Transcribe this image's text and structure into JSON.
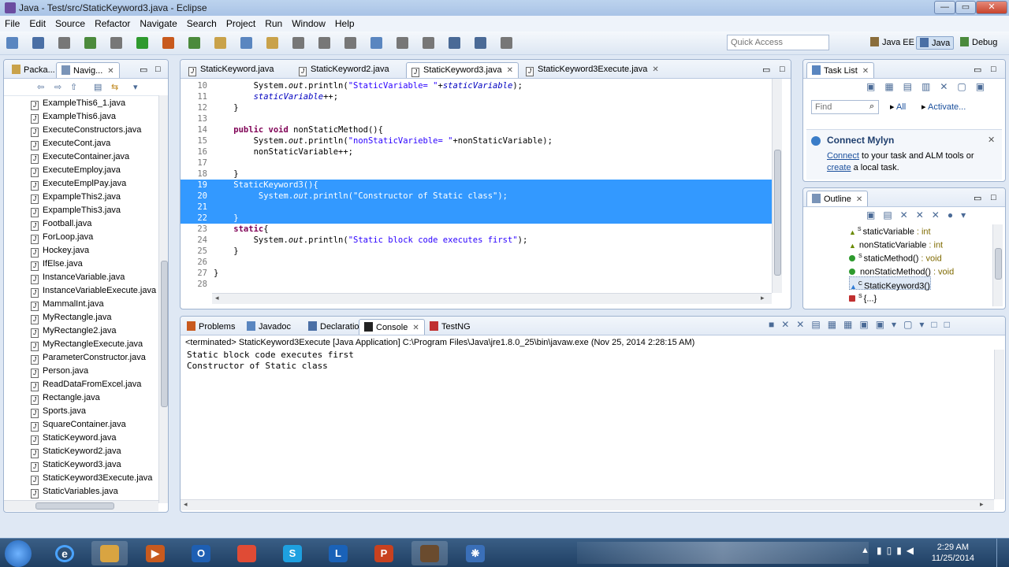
{
  "window": {
    "title": "Java - Test/src/StaticKeyword3.java - Eclipse",
    "min_label": "—",
    "max_label": "▭",
    "close_label": "✕"
  },
  "menu": [
    "File",
    "Edit",
    "Source",
    "Refactor",
    "Navigate",
    "Search",
    "Project",
    "Run",
    "Window",
    "Help"
  ],
  "toolbar": {
    "quick_access_placeholder": "Quick Access",
    "perspectives": [
      "Java EE",
      "Java",
      "Debug"
    ],
    "active_perspective": "Java"
  },
  "package_explorer": {
    "tabs": [
      "Packa...",
      "Navig..."
    ],
    "files": [
      "ExampleThis6_1.java",
      "ExampleThis6.java",
      "ExecuteConstructors.java",
      "ExecuteCont.java",
      "ExecuteContainer.java",
      "ExecuteEmploy.java",
      "ExecuteEmplPay.java",
      "ExpampleThis2.java",
      "ExpampleThis3.java",
      "Football.java",
      "ForLoop.java",
      "Hockey.java",
      "IfElse.java",
      "InstanceVariable.java",
      "InstanceVariableExecute.java",
      "MammalInt.java",
      "MyRectangle.java",
      "MyRectangle2.java",
      "MyRectangleExecute.java",
      "ParameterConstructor.java",
      "Person.java",
      "ReadDataFromExcel.java",
      "Rectangle.java",
      "Sports.java",
      "SquareContainer.java",
      "StaticKeyword.java",
      "StaticKeyword2.java",
      "StaticKeyword3.java",
      "StaticKeyword3Execute.java",
      "StaticVariables.java"
    ]
  },
  "editor": {
    "tabs": [
      "StaticKeyword.java",
      "StaticKeyword2.java",
      "StaticKeyword3.java",
      "StaticKeyword3Execute.java"
    ],
    "active_tab": "StaticKeyword3.java",
    "lines": [
      {
        "n": "10",
        "parts": [
          [
            "",
            "        System."
          ],
          [
            "it",
            "out"
          ],
          [
            "",
            ".println("
          ],
          [
            "str",
            "\"StaticVariable= \""
          ],
          [
            "",
            "+"
          ],
          [
            "fld",
            "staticVariable"
          ],
          [
            "",
            ");"
          ]
        ]
      },
      {
        "n": "11",
        "parts": [
          [
            "fld",
            "        staticVariable"
          ],
          [
            "",
            "++;"
          ]
        ]
      },
      {
        "n": "12",
        "parts": [
          [
            "",
            "    }"
          ]
        ]
      },
      {
        "n": "13",
        "parts": [
          [
            "",
            ""
          ]
        ]
      },
      {
        "n": "14",
        "parts": [
          [
            "kw",
            "    public void "
          ],
          [
            "",
            "nonStaticMethod(){"
          ]
        ]
      },
      {
        "n": "15",
        "parts": [
          [
            "",
            "        System."
          ],
          [
            "it",
            "out"
          ],
          [
            "",
            ".println("
          ],
          [
            "str",
            "\"nonStaticVarieble= \""
          ],
          [
            "",
            "+nonStaticVariable);"
          ]
        ]
      },
      {
        "n": "16",
        "parts": [
          [
            "",
            "        nonStaticVariable++;"
          ]
        ]
      },
      {
        "n": "17",
        "parts": [
          [
            "",
            ""
          ]
        ]
      },
      {
        "n": "18",
        "parts": [
          [
            "",
            "    }"
          ]
        ]
      },
      {
        "n": "19",
        "parts": [
          [
            "",
            "    StaticKeyword3(){"
          ]
        ],
        "selected": true
      },
      {
        "n": "20",
        "parts": [
          [
            "",
            "         System."
          ],
          [
            "it",
            "out"
          ],
          [
            "",
            ".println("
          ],
          [
            "str",
            "\"Constructor of Static class\""
          ],
          [
            "",
            ");"
          ]
        ],
        "selected": true
      },
      {
        "n": "21",
        "parts": [
          [
            "",
            ""
          ]
        ],
        "selected": true
      },
      {
        "n": "22",
        "parts": [
          [
            "",
            "    }"
          ]
        ],
        "selected": true
      },
      {
        "n": "23",
        "parts": [
          [
            "kw",
            "    static"
          ],
          [
            "",
            "{"
          ]
        ]
      },
      {
        "n": "24",
        "parts": [
          [
            "",
            "        System."
          ],
          [
            "it",
            "out"
          ],
          [
            "",
            ".println("
          ],
          [
            "str",
            "\"Static block code executes first\""
          ],
          [
            "",
            ");"
          ]
        ]
      },
      {
        "n": "25",
        "parts": [
          [
            "",
            "    }"
          ]
        ]
      },
      {
        "n": "26",
        "parts": [
          [
            "",
            ""
          ]
        ]
      },
      {
        "n": "27",
        "parts": [
          [
            "",
            "}"
          ]
        ]
      },
      {
        "n": "28",
        "parts": [
          [
            "",
            ""
          ]
        ]
      }
    ]
  },
  "task_list": {
    "title": "Task List",
    "find_placeholder": "Find",
    "all_label": "All",
    "activate_label": "Activate...",
    "mylyn_title": "Connect Mylyn",
    "mylyn_connect": "Connect",
    "mylyn_text1": " to your task and ALM tools or",
    "mylyn_create": "create",
    "mylyn_text2": " a local task."
  },
  "outline": {
    "title": "Outline",
    "items": [
      {
        "name": "staticVariable",
        "type": " : int",
        "sup": "S",
        "marker": "triangle",
        "color": "#6a8a00"
      },
      {
        "name": "nonStaticVariable",
        "type": " : int",
        "sup": "",
        "marker": "triangle",
        "color": "#6a8a00"
      },
      {
        "name": "staticMethod()",
        "type": " : void",
        "sup": "S",
        "marker": "dot",
        "color": "#2e9a2e"
      },
      {
        "name": "nonStaticMethod()",
        "type": " : void",
        "sup": "",
        "marker": "dot",
        "color": "#2e9a2e"
      },
      {
        "name": "StaticKeyword3()",
        "type": "",
        "sup": "C",
        "marker": "triangle",
        "color": "#2e7bd6",
        "selected": true
      },
      {
        "name": "{...}",
        "type": "",
        "sup": "S",
        "marker": "square",
        "color": "#c03030"
      }
    ]
  },
  "console": {
    "tabs": [
      "Problems",
      "Javadoc",
      "Declaration",
      "Console",
      "TestNG"
    ],
    "active_tab": "Console",
    "header": "<terminated> StaticKeyword3Execute [Java Application] C:\\Program Files\\Java\\jre1.8.0_25\\bin\\javaw.exe (Nov 25, 2014 2:28:15 AM)",
    "output": [
      "Static block code executes first",
      "Constructor of Static class"
    ]
  },
  "taskbar": {
    "apps": [
      {
        "name": "explorer",
        "label": "",
        "color": "#d9a441"
      },
      {
        "name": "media",
        "label": "▶",
        "color": "#c85a1e"
      },
      {
        "name": "outlook",
        "label": "O",
        "color": "#1e5fb3"
      },
      {
        "name": "chrome",
        "label": "",
        "color": "#e04b35"
      },
      {
        "name": "skype",
        "label": "S",
        "color": "#1ea0e0"
      },
      {
        "name": "lync",
        "label": "L",
        "color": "#1a62b8"
      },
      {
        "name": "powerpoint",
        "label": "P",
        "color": "#c8411f"
      },
      {
        "name": "eclipse",
        "label": "",
        "color": "#6a4b2e"
      },
      {
        "name": "gear-app",
        "label": "❋",
        "color": "#3a6fb8"
      }
    ],
    "time": "2:29 AM",
    "date": "11/25/2014"
  }
}
